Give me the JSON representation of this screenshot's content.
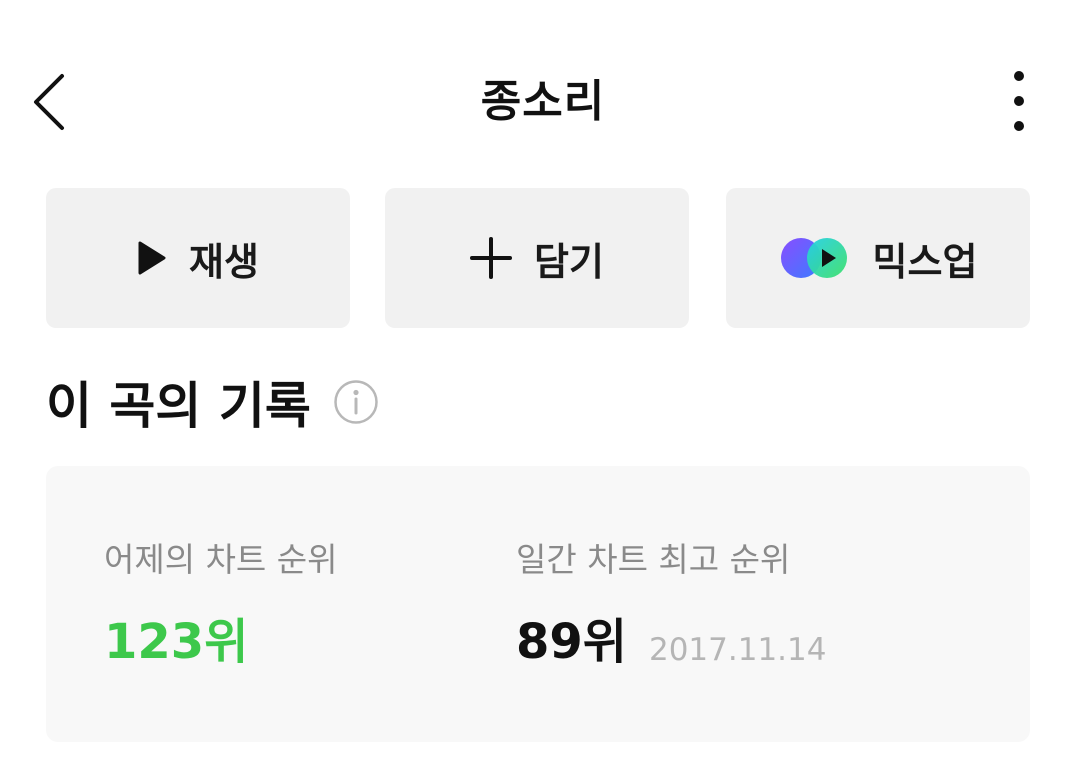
{
  "header": {
    "title": "종소리",
    "back_icon": "chevron-left-icon",
    "more_icon": "more-vertical-icon"
  },
  "actions": [
    {
      "label": "재생",
      "icon": "play-icon"
    },
    {
      "label": "담기",
      "icon": "plus-icon"
    },
    {
      "label": "믹스업",
      "icon": "mixup-icon"
    }
  ],
  "record": {
    "title": "이 곡의 기록",
    "info_icon": "info-icon",
    "yesterday_rank_label": "어제의 차트 순위",
    "yesterday_rank_value": "123위",
    "daily_best_label": "일간 차트 최고 순위",
    "daily_best_value": "89위",
    "daily_best_date": "2017.11.14"
  },
  "colors": {
    "accent_green": "#3dc84b",
    "button_bg": "#f1f1f1",
    "card_bg": "#f8f8f8",
    "label_gray": "#8a8a8a",
    "date_gray": "#b5b5b5"
  }
}
